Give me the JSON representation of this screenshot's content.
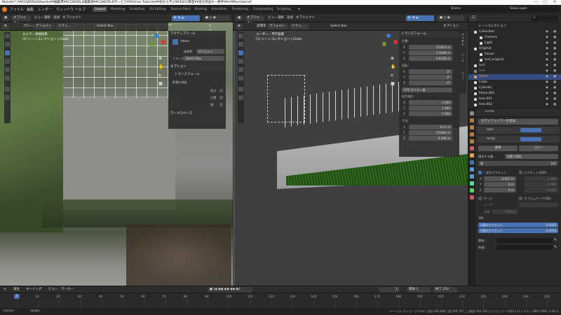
{
  "title_bar": {
    "text": "Blender* [¥¥CGWORLD¥works¥¥編集用¥¥CGWORLD編集部¥¥CGWORLDサービス¥¥Online Tutorials¥¥初から学ぶ¥¥3DCG教室¥¥実力作品キー勝手¥¥ref¥¥url.blend]",
    "minimize": "—",
    "maximize": "□",
    "close": "✕"
  },
  "menu": {
    "items": [
      "ファイル",
      "編集",
      "レンダー",
      "ウィンドウ",
      "ヘルプ"
    ],
    "workspace_tabs": [
      "Layout",
      "Modeling",
      "Sculpting",
      "UV Editing",
      "Texture Paint",
      "Shading",
      "Animation",
      "Rendering",
      "Compositing",
      "Scripting"
    ],
    "active_tab": "Layout",
    "scene": "Scene",
    "view_layer": "View Layer"
  },
  "left_viewport": {
    "header": {
      "mode": "オブジェクト...",
      "menus": [
        "ビュー",
        "選択",
        "追加",
        "オブジェクト"
      ],
      "transform": "グローバル",
      "pivot": "デフォルト",
      "drag": "ドラッ...",
      "select": "Select Box",
      "options": "オプション"
    },
    "overlay_title": "カメラ・透視投影",
    "overlay_sub": "(1) シーンコレクション | Circle",
    "active_tool_panel": {
      "header": "アクティブツール",
      "tool_name": "Move",
      "orientation_label": "座標系",
      "orientation_value": "デフォルト",
      "drag_label": "ドラッグ",
      "drag_value": "Select Box",
      "options_header": "オプション",
      "transform_header": "トランスフォーム",
      "affect_only": "影響の限定",
      "origin": "原点",
      "location": "位置",
      "parent": "親",
      "workspace_header": "ワークスペース"
    }
  },
  "right_viewport": {
    "header": {
      "mode": "オブジェクト...",
      "menus": [
        "ビュー",
        "選択",
        "追加",
        "オブジェクト"
      ],
      "transform": "座標系",
      "pivot": "デフォルト",
      "drag": "ドラッ...",
      "select": "Select Box",
      "options": "オプション"
    },
    "overlay_title": "ユーザー・平行投影",
    "overlay_sub": "(1) シーンコレクション | Circle",
    "transform_panel": {
      "header": "トランスフォーム",
      "location_label": "位置:",
      "loc_x": "0.5823 m",
      "loc_y": "6.5048 m",
      "loc_z": "0.8328 m",
      "rotation_label": "回転:",
      "rot_x": "0°",
      "rot_y": "0°",
      "rot_z": "0°",
      "mode": "XYZ オイラー角",
      "scale_label": "拡大縮小:",
      "scale_x": "1.000",
      "scale_y": "1.000",
      "scale_z": "1.000",
      "dimensions_label": "寸法:",
      "dim_x": "9.21 m",
      "dim_y": "0.0482 m",
      "dim_z": "0.398 m"
    },
    "side_tabs": [
      "アイテム",
      "ツール",
      "ビュー"
    ]
  },
  "outliner": {
    "header": "シーンコレクション",
    "rows": [
      {
        "name": "Collection",
        "indent": 1,
        "color": "#d8d8d8"
      },
      {
        "name": "Camera",
        "indent": 2,
        "color": "#d8d8d8"
      },
      {
        "name": "Light",
        "indent": 2,
        "color": "#d8d8d8"
      },
      {
        "name": "Original",
        "indent": 1,
        "color": "#d8d8d8"
      },
      {
        "name": "house",
        "indent": 2,
        "color": "#d8d8d8"
      },
      {
        "name": "turf_original",
        "indent": 2,
        "color": "#d8d8d8"
      },
      {
        "name": "turf",
        "indent": 1,
        "color": "#d8d8d8"
      },
      {
        "name": "tree",
        "indent": 1,
        "color": "#8a8a8a"
      },
      {
        "name": "Circle",
        "indent": 1,
        "color": "#e0a050"
      },
      {
        "name": "Cube",
        "indent": 1,
        "color": "#d8d8d8"
      },
      {
        "name": "Cylinder",
        "indent": 1,
        "color": "#d8d8d8"
      },
      {
        "name": "Plane.001",
        "indent": 1,
        "color": "#d8d8d8"
      },
      {
        "name": "tree.001",
        "indent": 1,
        "color": "#d8d8d8"
      },
      {
        "name": "tree.002",
        "indent": 1,
        "color": "#d8d8d8"
      }
    ]
  },
  "properties": {
    "object_name": "Circle",
    "add_modifier": "モディファイアーを追加",
    "modifier1": "Skin",
    "modifier2": "Array",
    "apply": "適用",
    "copy": "コピー",
    "fit_label": "適合する種...",
    "fit_value": "定数で指定",
    "count_label": "数",
    "count_value": "342",
    "relative_offset": "一定のオフセット",
    "relative_offset_right": "オフセット(倍率)",
    "offset_x": "0.027 m",
    "offset_y": "0 m",
    "offset_z": "0 m",
    "offset_right_x": "1.000",
    "offset_right_y": "0.000",
    "offset_right_z": "0.000",
    "merge": "マージ",
    "object_offset": "オブジェクトで(OB)",
    "first_last": "ループ",
    "distance": "距離",
    "distance_value": "0.01 m",
    "uv_header": "UV",
    "uv_offset_u": "U値のオフセット",
    "uv_offset_u_value": "0.0000",
    "uv_offset_v": "V値のオフセット",
    "uv_offset_v_value": "0.0000",
    "start_cap": "開始:",
    "end_cap": "終端:"
  },
  "timeline": {
    "menus": [
      "再生",
      "キーイング",
      "ビュー",
      "マーカー"
    ],
    "current_frame": "1",
    "start_label": "開始",
    "start_value": "1",
    "end_label": "終了",
    "end_value": "250",
    "ticks": [
      "0",
      "10",
      "20",
      "30",
      "40",
      "50",
      "60",
      "70",
      "80",
      "90",
      "100",
      "110",
      "120",
      "130",
      "140",
      "150",
      "160",
      "170",
      "180",
      "190",
      "200",
      "210",
      "220",
      "230",
      "240",
      "250"
    ]
  },
  "status_bar": {
    "left1": "Cancel",
    "left2": "Begin",
    "right": "シーンコレクション | Circle | 頂点:283,866 | 面:266,797 | 三角面:533,750 | オブジェクト:0/23,111 | メモリ:289.9 MiB | 2.83.4"
  },
  "colors": {
    "accent": "#4772b3",
    "panel_bg": "#2d2d2d",
    "field_bg": "#545454",
    "active_object": "#e0a050"
  }
}
